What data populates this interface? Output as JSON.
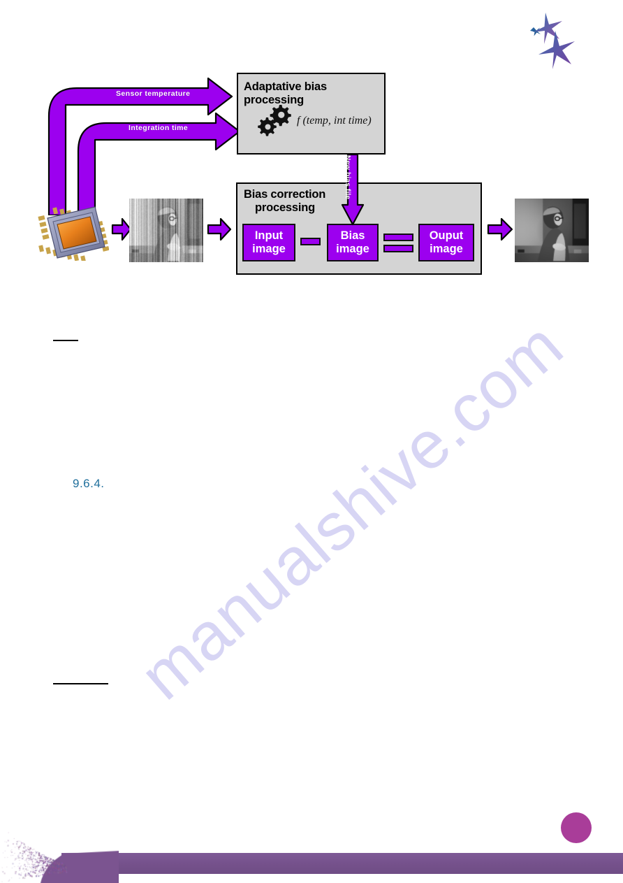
{
  "document": {
    "section_number": "9.6.4.",
    "page_badge_label": "",
    "watermark": "manualshive.com"
  },
  "logo": {
    "name": "company-star-logo",
    "star_colors": [
      "#1f5fa0",
      "#8e4a9e",
      "#6b3fa0"
    ]
  },
  "diagram": {
    "adaptive_block": {
      "title": "Adaptative bias processing",
      "formula": "f (temp, int time)",
      "icon": "gears-icon"
    },
    "bias_block": {
      "title_line1": "Bias correction",
      "title_line2": "processing",
      "input_box": {
        "line1": "Input",
        "line2": "image"
      },
      "bias_box": {
        "line1": "Bias",
        "line2": "image"
      },
      "output_box": {
        "line1": "Ouput",
        "line2": "image"
      },
      "minus_operator": "minus-sign",
      "equals_operator": "equals-sign"
    },
    "arrows": {
      "sensor_temperature_label": "Sensor temperature",
      "integration_time_label": "Integration time",
      "new_bias_file_label": "New bias file",
      "flow_arrow_sensor_to_input": "arrow-right-icon",
      "flow_arrow_input_to_block": "arrow-right-icon",
      "flow_arrow_block_to_output": "arrow-right-icon"
    },
    "images": {
      "sensor_chip": "image-sensor-chip",
      "noisy_image": "noisy-input-image",
      "clean_image": "corrected-output-image"
    }
  },
  "colors": {
    "purple_accent": "#9c00ef",
    "box_fill": "#d4d4d4",
    "footer_purple": "#75518b",
    "badge_magenta": "#a93d99",
    "section_blue": "#1f6f9c",
    "watermark_lavender": "#c9c6f0"
  }
}
